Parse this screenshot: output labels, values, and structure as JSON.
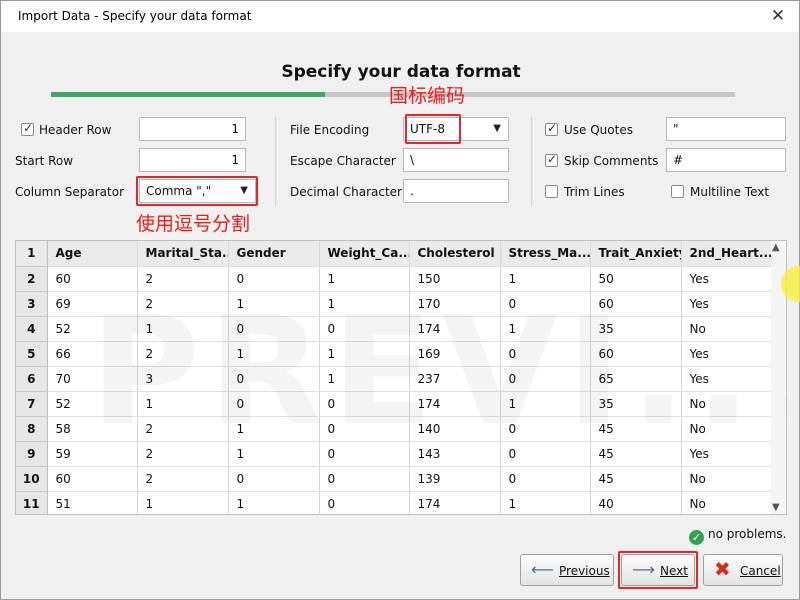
{
  "window": {
    "title": "Import Data - Specify your data format",
    "close_label": "✕"
  },
  "wizard": {
    "heading": "Specify your data format",
    "progress_fraction": 0.4
  },
  "annotations": {
    "encoding_note": "国标编码",
    "separator_note": "使用逗号分割"
  },
  "left_options": {
    "header_row_label": "Header Row",
    "header_row_checked": true,
    "header_row_value": "1",
    "start_row_label": "Start Row",
    "start_row_value": "1",
    "column_separator_label": "Column Separator",
    "column_separator_value": "Comma \",\""
  },
  "middle_options": {
    "file_encoding_label": "File Encoding",
    "file_encoding_value": "UTF-8",
    "escape_character_label": "Escape Character",
    "escape_character_value": "\\",
    "decimal_character_label": "Decimal Character",
    "decimal_character_value": "."
  },
  "right_options": {
    "use_quotes_label": "Use Quotes",
    "use_quotes_checked": true,
    "use_quotes_value": "\"",
    "skip_comments_label": "Skip Comments",
    "skip_comments_checked": true,
    "skip_comments_value": "#",
    "trim_lines_label": "Trim Lines",
    "trim_lines_checked": false,
    "multiline_text_label": "Multiline Text",
    "multiline_text_checked": false
  },
  "preview": {
    "watermark": "PREVI...",
    "header_row_number": "1",
    "columns": [
      "Age",
      "Marital_Sta...",
      "Gender",
      "Weight_Ca...",
      "Cholesterol",
      "Stress_Ma...",
      "Trait_Anxiety",
      "2nd_Heart..."
    ],
    "rows": [
      {
        "n": "2",
        "cells": [
          "60",
          "2",
          "0",
          "1",
          "150",
          "1",
          "50",
          "Yes"
        ]
      },
      {
        "n": "3",
        "cells": [
          "69",
          "2",
          "1",
          "1",
          "170",
          "0",
          "60",
          "Yes"
        ]
      },
      {
        "n": "4",
        "cells": [
          "52",
          "1",
          "0",
          "0",
          "174",
          "1",
          "35",
          "No"
        ]
      },
      {
        "n": "5",
        "cells": [
          "66",
          "2",
          "1",
          "1",
          "169",
          "0",
          "60",
          "Yes"
        ]
      },
      {
        "n": "6",
        "cells": [
          "70",
          "3",
          "0",
          "1",
          "237",
          "0",
          "65",
          "Yes"
        ]
      },
      {
        "n": "7",
        "cells": [
          "52",
          "1",
          "0",
          "0",
          "174",
          "1",
          "35",
          "No"
        ]
      },
      {
        "n": "8",
        "cells": [
          "58",
          "2",
          "1",
          "0",
          "140",
          "0",
          "45",
          "No"
        ]
      },
      {
        "n": "9",
        "cells": [
          "59",
          "2",
          "1",
          "0",
          "143",
          "0",
          "45",
          "Yes"
        ]
      },
      {
        "n": "10",
        "cells": [
          "60",
          "2",
          "0",
          "0",
          "139",
          "0",
          "45",
          "No"
        ]
      },
      {
        "n": "11",
        "cells": [
          "51",
          "1",
          "1",
          "0",
          "174",
          "1",
          "40",
          "No"
        ]
      }
    ]
  },
  "status": {
    "message": "no problems."
  },
  "buttons": {
    "previous": "Previous",
    "next": "Next",
    "cancel": "Cancel"
  }
}
